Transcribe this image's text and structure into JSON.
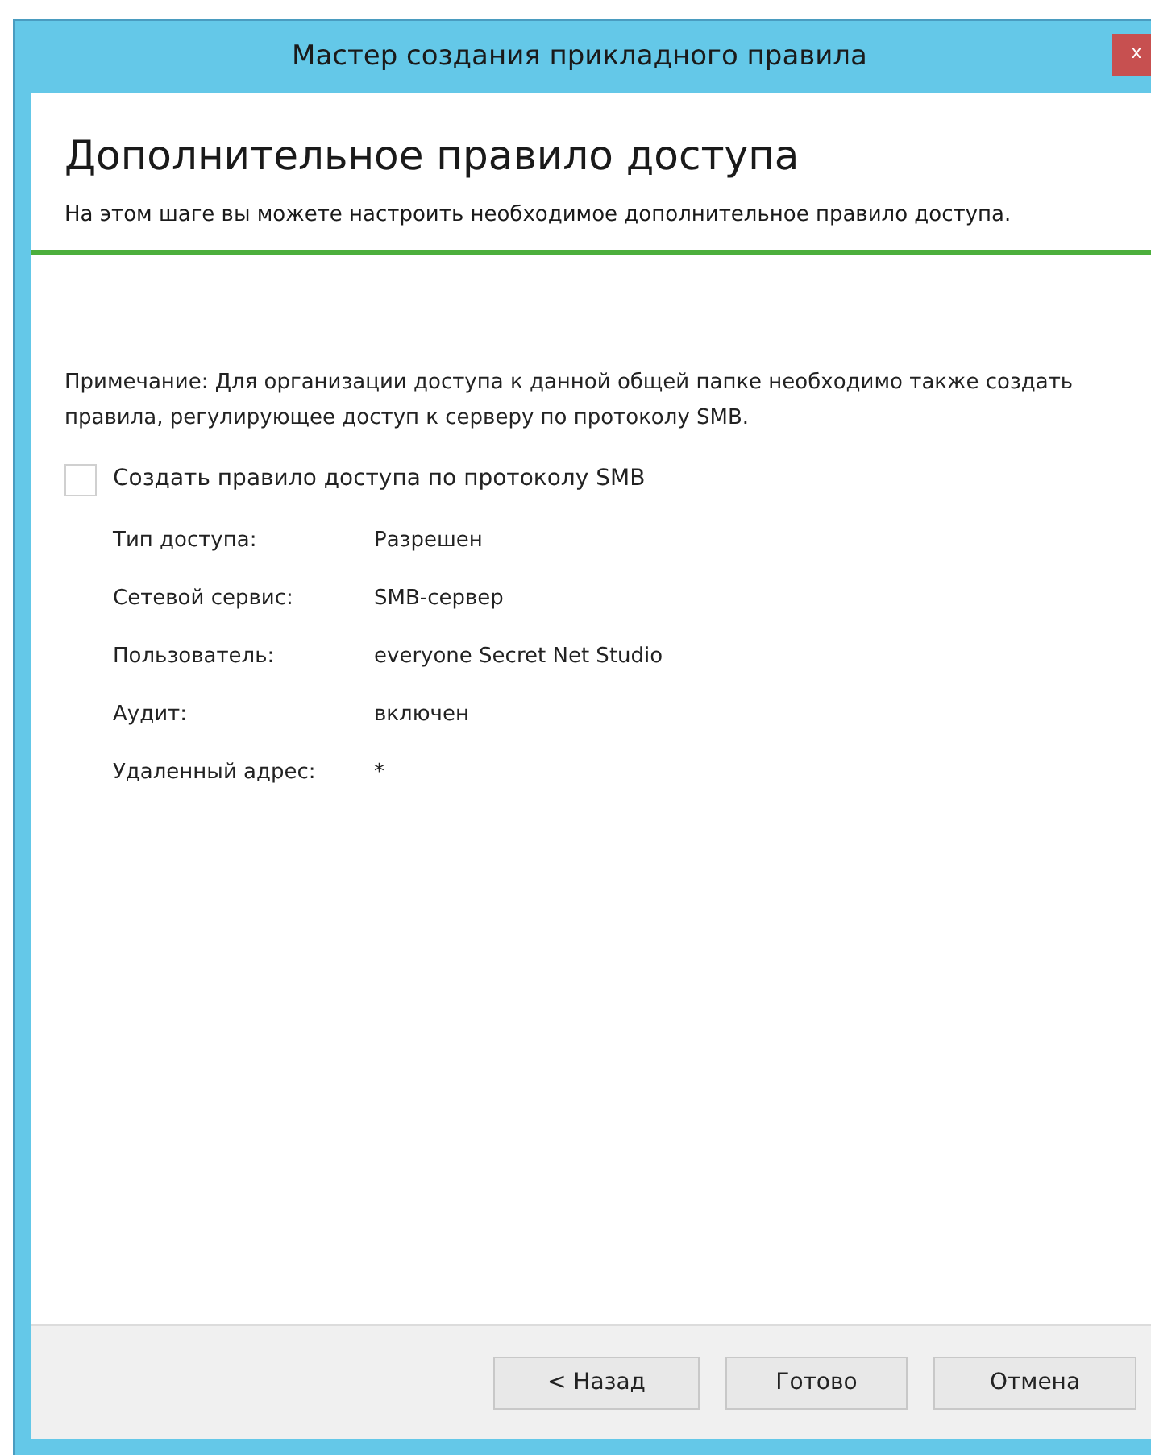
{
  "window": {
    "title": "Мастер создания прикладного правила",
    "close": "x"
  },
  "header": {
    "title": "Дополнительное правило доступа",
    "description": "На этом шаге вы можете настроить необходимое дополнительное правило доступа."
  },
  "note": "Примечание: Для организации доступа к данной общей папке необходимо также создать правила, регулирующее доступ к серверу по протоколу  SMB.",
  "checkbox": {
    "label": "Создать правило доступа по протоколу SMB",
    "checked": false
  },
  "properties": [
    {
      "label": "Тип доступа:",
      "value": "Разрешен"
    },
    {
      "label": "Сетевой сервис:",
      "value": "SMB-сервер"
    },
    {
      "label": "Пользователь:",
      "value": "everyone Secret Net Studio"
    },
    {
      "label": "Аудит:",
      "value": "включен"
    },
    {
      "label": "Удаленный адрес:",
      "value": "*"
    }
  ],
  "buttons": [
    "< Назад",
    "Готово",
    "Отмена"
  ]
}
